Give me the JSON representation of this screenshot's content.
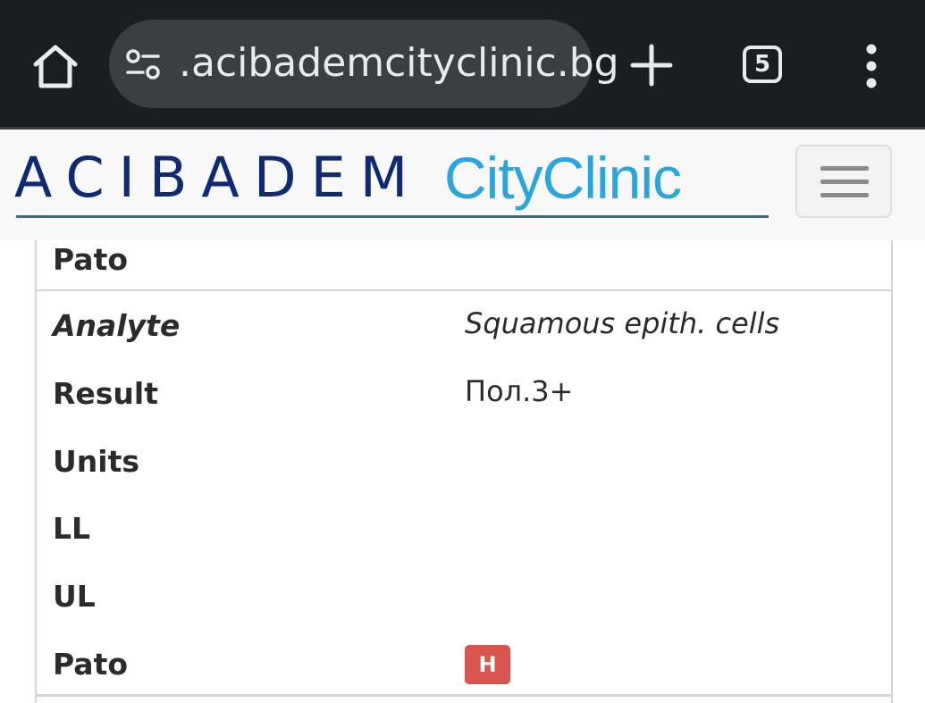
{
  "browser": {
    "url": ".acibademcityclinic.bg",
    "tab_count": "5",
    "icons": [
      "home-icon",
      "site-settings-icon",
      "plus-icon",
      "tab-switcher-icon",
      "more-vert-icon"
    ],
    "colors": {
      "chrome_bg": "#1b1d21",
      "urlbar_bg": "#3b3e44",
      "text": "#e8eaed"
    }
  },
  "site": {
    "logo_left": "ACIBADEM",
    "logo_right": "CityClinic",
    "colors": {
      "logo_dark": "#0d2a73",
      "logo_light": "#2aa6dd",
      "badge": "#d9534f"
    }
  },
  "results": {
    "previous_row_label": "Pato",
    "record": {
      "analyte_label": "Analyte",
      "analyte_value": "Squamous epith. cells",
      "result_label": "Result",
      "result_value": "Пол.3+",
      "units_label": "Units",
      "ll_label": "LL",
      "ul_label": "UL",
      "pato_label": "Pato",
      "pato_flag": "H"
    }
  }
}
